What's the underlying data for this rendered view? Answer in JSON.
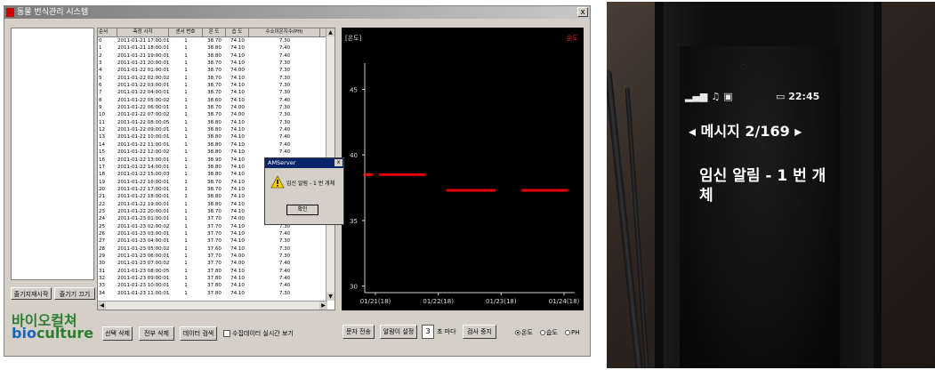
{
  "window": {
    "title": "동물 번식관리 시스템",
    "close": "x"
  },
  "left_panel": {
    "buttons": {
      "start": "줄기지재시작",
      "stop": "줄기기 끄기"
    },
    "logo_kr": "바이오컬쳐",
    "logo_en_bio": "bio",
    "logo_en_culture": "culture"
  },
  "table": {
    "columns": [
      "순서",
      "측정 시각",
      "센서 번호",
      "온 도",
      "습 도",
      "수소이온지수(PH)"
    ],
    "rows": [
      [
        "0",
        "2011-01-21 17:00:01",
        "1",
        "38.70",
        "74.10",
        "7.30"
      ],
      [
        "1",
        "2011-01-21 18:00:01",
        "1",
        "38.80",
        "74.10",
        "7.40"
      ],
      [
        "2",
        "2011-01-21 19:00:01",
        "1",
        "38.80",
        "74.10",
        "7.40"
      ],
      [
        "3",
        "2011-01-21 20:00:01",
        "1",
        "38.70",
        "74.10",
        "7.30"
      ],
      [
        "4",
        "2011-01-22 01:00:01",
        "1",
        "38.70",
        "74.00",
        "7.30"
      ],
      [
        "5",
        "2011-01-22 02:00:02",
        "1",
        "38.70",
        "74.10",
        "7.30"
      ],
      [
        "6",
        "2011-01-22 03:00:01",
        "1",
        "38.70",
        "74.10",
        "7.30"
      ],
      [
        "7",
        "2011-01-22 04:00:01",
        "1",
        "38.70",
        "74.10",
        "7.30"
      ],
      [
        "8",
        "2011-01-22 05:00:02",
        "1",
        "38.60",
        "74.10",
        "7.40"
      ],
      [
        "9",
        "2011-01-22 06:00:01",
        "1",
        "38.70",
        "74.00",
        "7.30"
      ],
      [
        "10",
        "2011-01-22 07:00:02",
        "1",
        "38.70",
        "74.00",
        "7.30"
      ],
      [
        "11",
        "2011-01-22 08:00:05",
        "1",
        "38.80",
        "74.10",
        "7.30"
      ],
      [
        "12",
        "2011-01-22 09:00:01",
        "1",
        "38.80",
        "74.10",
        "7.40"
      ],
      [
        "13",
        "2011-01-22 10:00:01",
        "1",
        "38.80",
        "74.10",
        "7.40"
      ],
      [
        "14",
        "2011-01-22 11:00:01",
        "1",
        "38.80",
        "74.10",
        "7.40"
      ],
      [
        "15",
        "2011-01-22 12:00:02",
        "1",
        "38.80",
        "74.10",
        "7.40"
      ],
      [
        "16",
        "2011-01-22 13:00:01",
        "1",
        "38.90",
        "74.10",
        "7.30"
      ],
      [
        "17",
        "2011-01-22 14:00:01",
        "1",
        "38.80",
        "74.10",
        "7.30"
      ],
      [
        "18",
        "2011-01-22 15:00:03",
        "1",
        "38.80",
        "74.10",
        "7.40"
      ],
      [
        "19",
        "2011-01-22 16:00:01",
        "1",
        "38.70",
        "74.10",
        "7.30"
      ],
      [
        "20",
        "2011-01-22 17:00:01",
        "1",
        "38.70",
        "74.10",
        "7.30"
      ],
      [
        "21",
        "2011-01-22 18:00:01",
        "1",
        "38.80",
        "74.10",
        "7.40"
      ],
      [
        "22",
        "2011-01-22 19:00:01",
        "1",
        "38.80",
        "74.10",
        "7.30"
      ],
      [
        "23",
        "2011-01-22 20:00:01",
        "1",
        "38.70",
        "74.10",
        "7.30"
      ],
      [
        "24",
        "2011-01-23 01:00:01",
        "1",
        "37.70",
        "74.00",
        "7.30"
      ],
      [
        "25",
        "2011-01-23 02:00:02",
        "1",
        "37.70",
        "74.10",
        "7.30"
      ],
      [
        "26",
        "2011-01-23 03:00:01",
        "1",
        "37.70",
        "74.10",
        "7.40"
      ],
      [
        "27",
        "2011-01-23 04:00:01",
        "1",
        "37.70",
        "74.10",
        "7.30"
      ],
      [
        "28",
        "2011-01-23 05:00:02",
        "1",
        "37.60",
        "74.10",
        "7.30"
      ],
      [
        "29",
        "2011-01-23 06:00:01",
        "1",
        "37.70",
        "74.00",
        "7.30"
      ],
      [
        "30",
        "2011-01-23 07:00:02",
        "1",
        "37.70",
        "74.00",
        "7.40"
      ],
      [
        "31",
        "2011-01-23 08:00:05",
        "1",
        "37.80",
        "74.10",
        "7.40"
      ],
      [
        "32",
        "2011-01-23 09:00:01",
        "1",
        "37.80",
        "74.10",
        "7.40"
      ],
      [
        "33",
        "2011-01-23 10:00:01",
        "1",
        "37.80",
        "74.10",
        "7.40"
      ],
      [
        "34",
        "2011-01-23 11:00:01",
        "1",
        "37.80",
        "74.10",
        "7.30"
      ]
    ]
  },
  "chart_data": {
    "type": "scatter",
    "ylabel": "[온도]",
    "legend": [
      "온도"
    ],
    "legend_placement": "top-right",
    "yticks": [
      30,
      35,
      40,
      45
    ],
    "ylim": [
      29.5,
      47
    ],
    "xlabels": [
      "01/21(18)",
      "01/22(18)",
      "01/23(18)",
      "01/24(18)"
    ],
    "xlim": [
      0,
      84
    ],
    "series": [
      {
        "name": "온도",
        "color": "#ff0000",
        "segments": [
          {
            "x_start": 0,
            "x_end": 3,
            "y": 38.5
          },
          {
            "x_start": 6,
            "x_end": 24,
            "y": 38.5
          },
          {
            "x_start": 33,
            "x_end": 52,
            "y": 37.3
          },
          {
            "x_start": 63,
            "x_end": 81,
            "y": 37.3
          }
        ]
      }
    ],
    "grid": false
  },
  "dialog": {
    "title": "AMServer",
    "close": "x",
    "message": "임신 알림 - 1 번 개체",
    "ok": "확인"
  },
  "bottom_bar": {
    "select_delete": "선택 삭제",
    "delete_all": "전부 삭제",
    "data_search": "데이터 검색",
    "realtime_label": "수집데이터 실시간 보기",
    "send_text": "문자 전송",
    "alarm_setting": "알람이 설정",
    "interval_value": "3",
    "interval_unit": "초 마다",
    "stop_check": "검사 중지",
    "radio_temp": "온도",
    "radio_humid": "습도",
    "radio_ph": "PH"
  },
  "phone": {
    "time": "22:45",
    "message_counter": "메시지 2/169",
    "message_text": "임신 알림 - 1 번 개체"
  }
}
